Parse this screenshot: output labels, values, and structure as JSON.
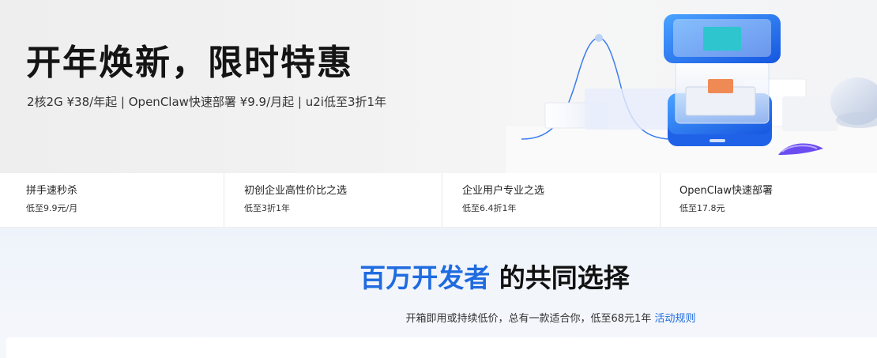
{
  "hero": {
    "title": "开年焕新，限时特惠",
    "subtitle": "2核2G ¥38/年起 | OpenClaw快速部署 ¥9.9/月起 | u2i低至3折1年"
  },
  "promos": [
    {
      "title": "拼手速秒杀",
      "desc": "低至9.9元/月"
    },
    {
      "title": "初创企业高性价比之选",
      "desc": "低至3折1年"
    },
    {
      "title": "企业用户专业之选",
      "desc": "低至6.4折1年"
    },
    {
      "title": "OpenClaw快速部署",
      "desc": "低至17.8元"
    }
  ],
  "section": {
    "heading_highlight": "百万开发者",
    "heading_rest": " 的共同选择",
    "subtitle": "开箱即用或持续低价，总有一款适合你，低至68元1年 ",
    "link": "活动规则"
  },
  "colors": {
    "accent": "#1f6be0",
    "hero_bg": "#f0f0f0",
    "section_bg": "#eef3fb"
  }
}
